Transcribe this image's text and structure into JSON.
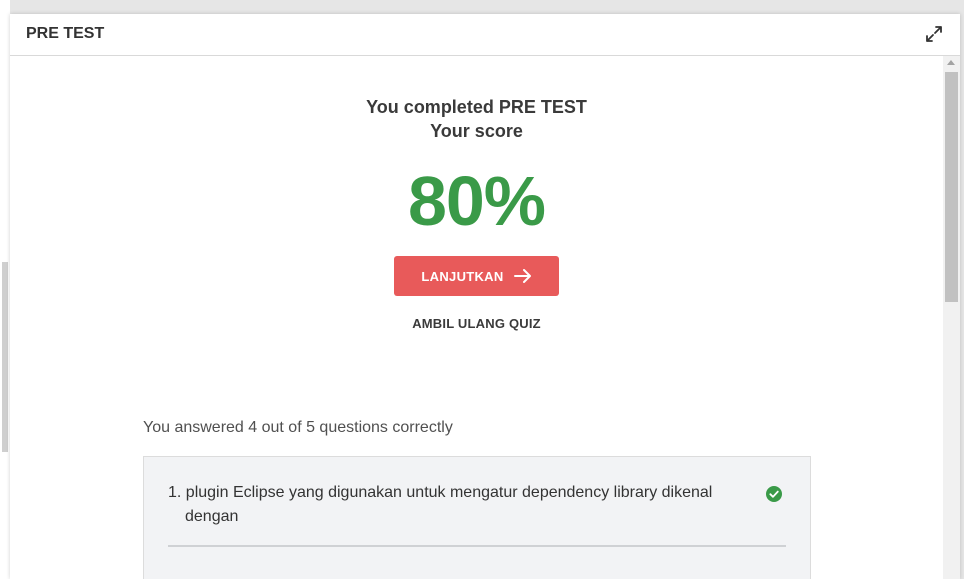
{
  "header": {
    "title": "PRE TEST",
    "expand_icon": "expand-icon"
  },
  "result": {
    "completed_message": "You completed PRE TEST",
    "score_label": "Your score",
    "score_value": "80%",
    "score_color": "#3a9a48"
  },
  "actions": {
    "continue_label": "LANJUTKAN",
    "continue_icon": "arrow-right-icon",
    "continue_color": "#e85a5a",
    "retake_label": "AMBIL ULANG QUIZ"
  },
  "summary": {
    "answered_text": "You answered 4 out of 5 questions correctly"
  },
  "questions": [
    {
      "text": "1. plugin Eclipse yang digunakan untuk mengatur dependency library dikenal dengan",
      "status": "correct",
      "status_icon": "check-circle-icon",
      "status_color": "#3a9a48"
    }
  ]
}
